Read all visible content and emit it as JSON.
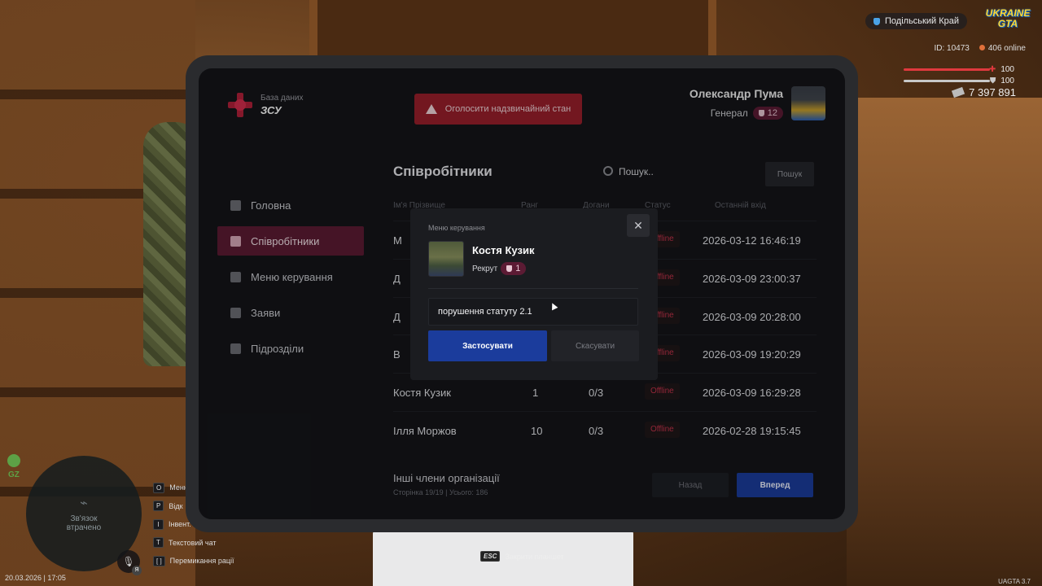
{
  "hud": {
    "server_name": "Подільський Край",
    "logo_text_1": "UKRAINE",
    "logo_text_2": "GTA",
    "player_id": "ID: 10473",
    "online": "406 online",
    "health": "100",
    "armor": "100",
    "money": "7 397 891",
    "map_status": "Зв'язок втрачено",
    "gz_label": "GZ",
    "mic_badge": "Я",
    "datetime": "20.03.2026 | 17:05",
    "version": "UAGTA 3.7",
    "esc_key": "ESC",
    "esc_label": "Закрити планшет",
    "keybinds": [
      {
        "key": "O",
        "label": "Меню"
      },
      {
        "key": "P",
        "label": "Відк"
      },
      {
        "key": "I",
        "label": "Інвент."
      },
      {
        "key": "T",
        "label": "Текстовий чат"
      },
      {
        "key": "[ ]",
        "label": "Перемикання рації"
      }
    ],
    "health_color": "#e0393e",
    "armor_color": "#c8c8c8"
  },
  "app": {
    "brand_sub": "База даних",
    "brand_title": "ЗСУ",
    "emergency_label": "Оголосити надзвичайний стан",
    "user_name": "Олександр Пума",
    "user_rank": "Генерал",
    "user_rank_level": "12"
  },
  "sidebar": {
    "items": [
      {
        "label": "Головна",
        "icon": "home-icon"
      },
      {
        "label": "Співробітники",
        "icon": "users-icon",
        "active": true
      },
      {
        "label": "Меню керування",
        "icon": "gear-icon"
      },
      {
        "label": "Заяви",
        "icon": "folder-icon"
      },
      {
        "label": "Підрозділи",
        "icon": "shield-icon"
      }
    ]
  },
  "employees": {
    "title": "Співробітники",
    "search_placeholder": "Пошук..",
    "search_button": "Пошук",
    "columns": [
      "Ім'я Прізвище",
      "Ранг",
      "Догани",
      "Статус",
      "Останній вхід"
    ],
    "rows": [
      {
        "name": "М",
        "rank": "",
        "warnings": "",
        "status": "Offline",
        "last_login": "2026-03-12 16:46:19"
      },
      {
        "name": "Д",
        "rank": "",
        "warnings": "",
        "status": "Offline",
        "last_login": "2026-03-09 23:00:37"
      },
      {
        "name": "Д",
        "rank": "",
        "warnings": "",
        "status": "Offline",
        "last_login": "2026-03-09 20:28:00"
      },
      {
        "name": "В",
        "rank": "",
        "warnings": "",
        "status": "Offline",
        "last_login": "2026-03-09 19:20:29"
      },
      {
        "name": "Костя Кузик",
        "rank": "1",
        "warnings": "0/3",
        "status": "Offline",
        "last_login": "2026-03-09 16:29:28"
      },
      {
        "name": "Ілля Моржов",
        "rank": "10",
        "warnings": "0/3",
        "status": "Offline",
        "last_login": "2026-02-28 19:15:45"
      }
    ],
    "footer_title": "Інші члени організації",
    "footer_sub": "Сторінка 19/19 | Усього: 186",
    "back_label": "Назад",
    "next_label": "Вперед",
    "status_color": "#c6334b"
  },
  "modal": {
    "title": "Меню керування",
    "employee_name": "Костя Кузик",
    "employee_rank": "Рекрут",
    "employee_rank_level": "1",
    "reason_value": "порушення статуту 2.1",
    "apply_label": "Застосувати",
    "cancel_label": "Скасувати",
    "close_icon": "close-icon"
  }
}
